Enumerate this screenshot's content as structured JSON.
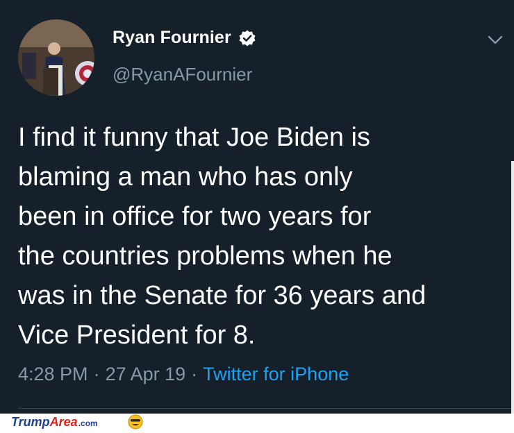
{
  "tweet": {
    "author_name": "Ryan Fournier",
    "handle": "@RyanAFournier",
    "verified": true,
    "text": "I find it funny that Joe Biden is\nblaming a man who has only\nbeen in office for two years for\nthe countries problems when he\nwas in the Senate for 36 years and\nVice President for 8.",
    "time": "4:28 PM",
    "date": "27 Apr 19",
    "separator": "·",
    "source": "Twitter for iPhone",
    "menu_icon": "chevron-down-icon",
    "avatar_icon": "avatar"
  },
  "watermark": {
    "part1": "Trump",
    "part2": "Area",
    "part3": ".com",
    "emoji_icon": "smiley-emoji-icon"
  },
  "colors": {
    "background": "#15202b",
    "text": "#ffffff",
    "secondary": "#8899a6",
    "link": "#1da1f2"
  }
}
